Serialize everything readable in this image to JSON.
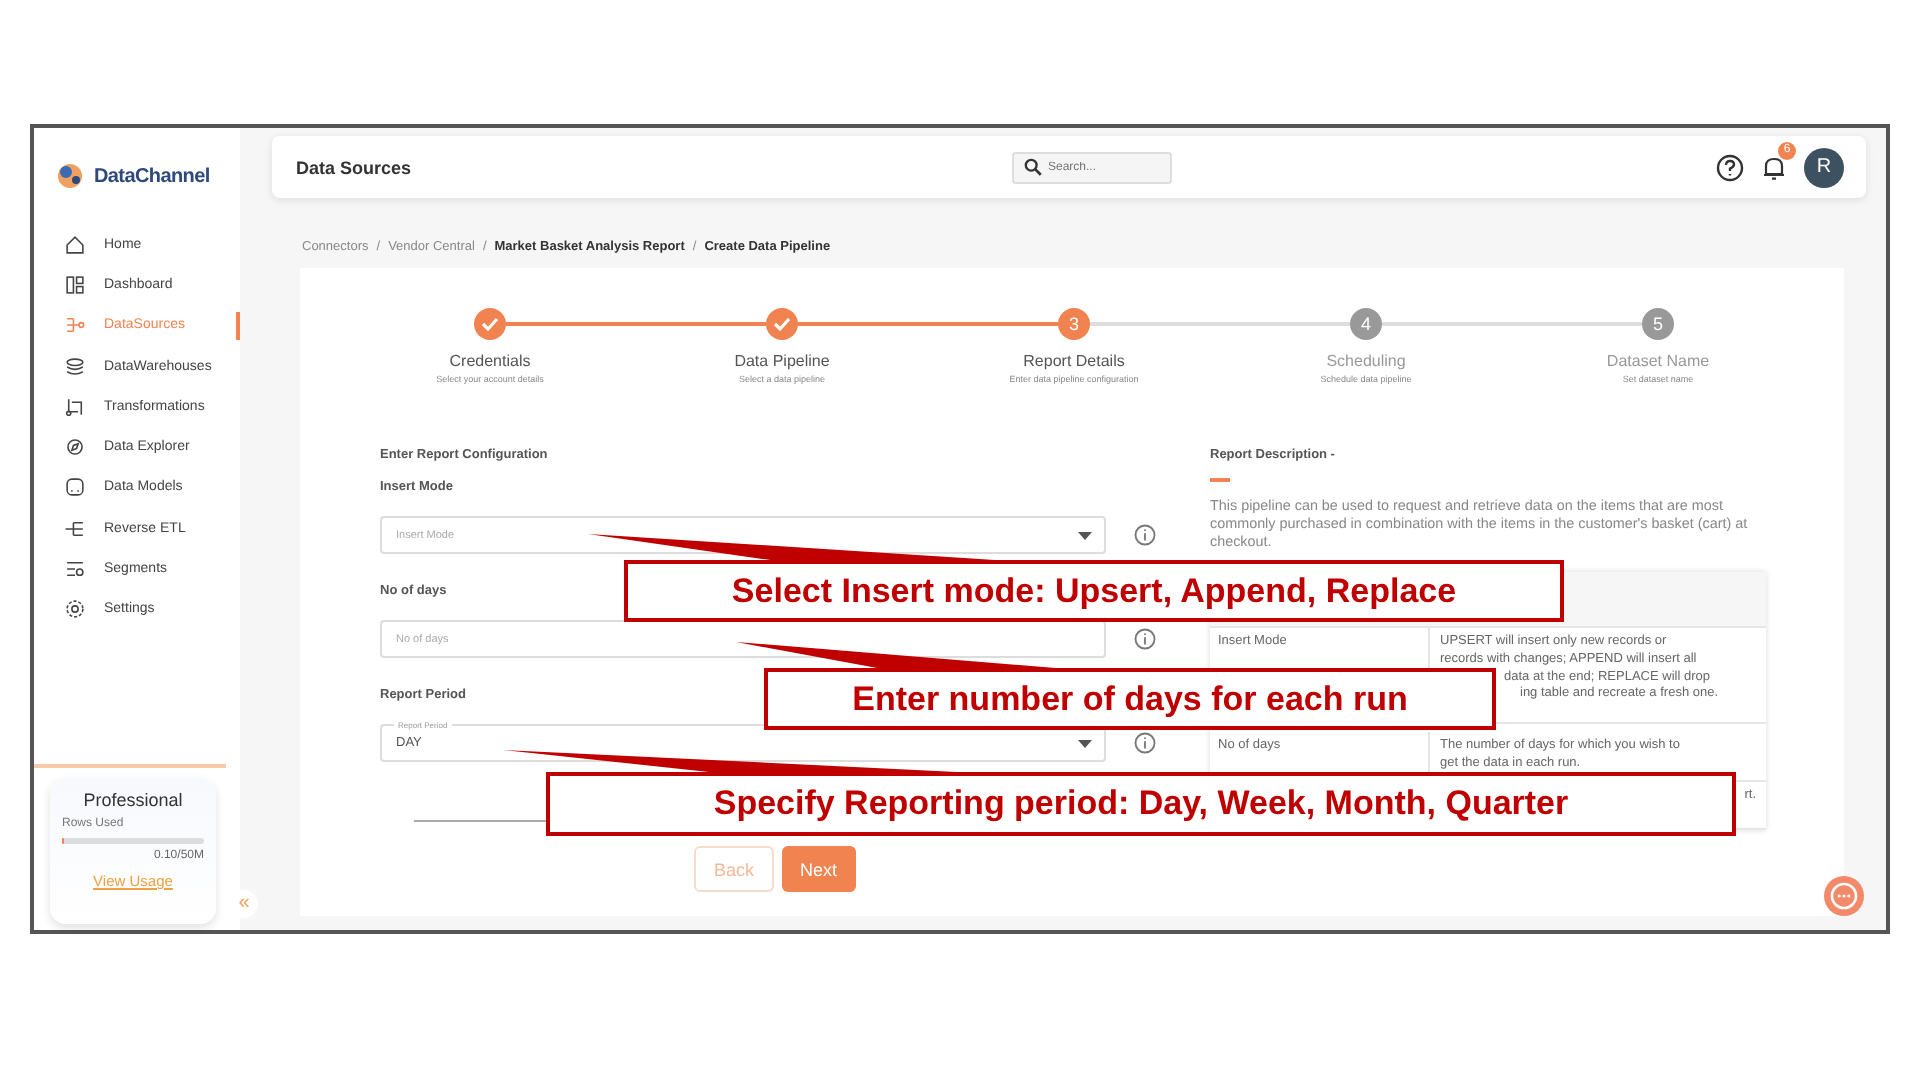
{
  "sidebar": {
    "logo": "DataChannel",
    "items": [
      {
        "label": "Home",
        "selected": false
      },
      {
        "label": "Dashboard",
        "selected": false
      },
      {
        "label": "DataSources",
        "selected": true
      },
      {
        "label": "DataWarehouses",
        "selected": false
      },
      {
        "label": "Transformations",
        "selected": false
      },
      {
        "label": "Data Explorer",
        "selected": false
      },
      {
        "label": "Data Models",
        "selected": false
      },
      {
        "label": "Reverse ETL",
        "selected": false
      },
      {
        "label": "Segments",
        "selected": false
      },
      {
        "label": "Settings",
        "selected": false
      }
    ],
    "plan": {
      "title": "Professional",
      "usage_label": "Rows Used",
      "level": 0.01,
      "usage": "0.10/50M",
      "link": "View Usage"
    },
    "collapse": "«"
  },
  "header": {
    "title": "Data Sources",
    "search_placeholder": "Search...",
    "notifications": "6",
    "avatar": "R"
  },
  "breadcrumb": [
    {
      "label": "Connectors",
      "current": false
    },
    {
      "separator": "/",
      "label": "Vendor Central",
      "current": false
    },
    {
      "separator": "/",
      "label": "Market Basket Analysis Report",
      "current": true
    },
    {
      "separator": "/",
      "label": "Create Data Pipeline",
      "current": true
    }
  ],
  "steps": [
    {
      "label": "Credentials",
      "sublabel": "Select your account details",
      "completed": true,
      "active": false
    },
    {
      "label": "Data Pipeline",
      "sublabel": "Select a data pipeline",
      "completed": true,
      "active": false
    },
    {
      "label": "Report Details",
      "sublabel": "Enter data pipeline configuration",
      "completed": false,
      "active": true,
      "number": "3"
    },
    {
      "label": "Scheduling",
      "sublabel": "Schedule data pipeline",
      "completed": false,
      "active": false,
      "number": "4"
    },
    {
      "label": "Dataset Name",
      "sublabel": "Set dataset name",
      "completed": false,
      "active": false,
      "number": "5"
    }
  ],
  "form": {
    "heading": "Enter Report Configuration",
    "fields": [
      {
        "label": "Insert Mode",
        "kind": "select",
        "placeholder": "Insert Mode"
      },
      {
        "label": "No of days",
        "kind": "text",
        "placeholder": "No of days"
      },
      {
        "label": "Report Period",
        "kind": "select",
        "floating_label": "Report Period",
        "value": "DAY"
      }
    ],
    "buttons": [
      {
        "label": "Back",
        "kind": "back",
        "disabled": true
      },
      {
        "label": "Next",
        "kind": "next",
        "disabled": false
      }
    ]
  },
  "description": {
    "title": "Report Description -",
    "text": "This pipeline can be used to request and retrieve data on the items that are most commonly purchased in combination with the items in the customer's basket (cart) at checkout.",
    "rows": [
      {
        "field": "Insert Mode",
        "lines": [
          "UPSERT will insert only new records or",
          "records with changes; APPEND will insert all",
          "data at the end; REPLACE will drop",
          "ing table and recreate a fresh one."
        ]
      },
      {
        "field": "No of days",
        "lines": [
          "The number of days for which you wish to",
          "get the data in each run."
        ]
      },
      {
        "lines": [
          "rt."
        ]
      }
    ]
  },
  "callouts": [
    {
      "text": "Select Insert mode: Upsert, Append, Replace"
    },
    {
      "text": "Enter number of days for each run"
    },
    {
      "text": "Specify Reporting period: Day, Week, Month, Quarter"
    }
  ]
}
